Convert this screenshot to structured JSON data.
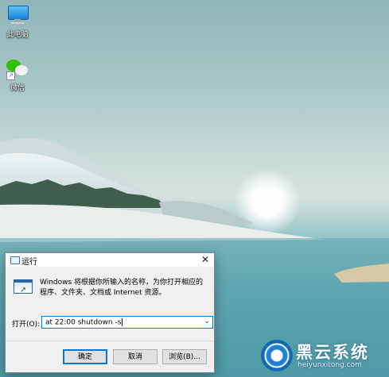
{
  "desktop": {
    "icons": [
      {
        "label": "此电脑",
        "icon": "computer-icon"
      },
      {
        "label": "微信",
        "icon": "wechat-icon"
      }
    ],
    "colors": {
      "sky": "#a7c6c6",
      "water": "#4f9eab",
      "accent": "#0078d7"
    }
  },
  "run_dialog": {
    "title": "运行",
    "close_glyph": "✕",
    "description": "Windows 将根据你所输入的名称，为你打开相应的程序、文件夹、文档或 Internet 资源。",
    "open_label": "打开(O):",
    "input_value": "at 22:00 shutdown -s",
    "dropdown_glyph": "⌄",
    "buttons": {
      "ok": "确定",
      "cancel": "取消",
      "browse": "浏览(B)..."
    }
  },
  "watermark": {
    "brand": "黑云系统",
    "site": "heiyunxitong.com"
  }
}
